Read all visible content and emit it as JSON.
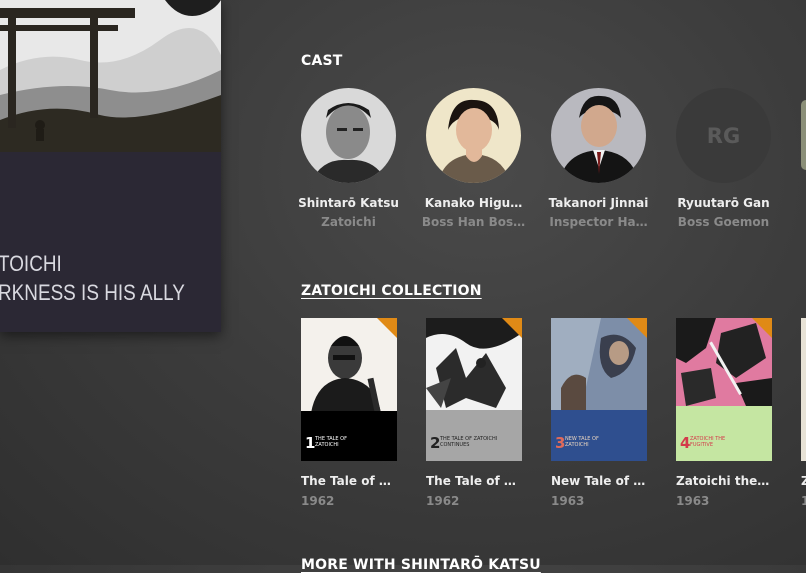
{
  "poster": {
    "title_line1": "TOICHI",
    "title_line2": "RKNESS IS HIS ALLY"
  },
  "cast": {
    "heading": "CAST",
    "members": [
      {
        "name": "Shintarō Katsu",
        "role": "Zatoichi"
      },
      {
        "name": "Kanako Higu…",
        "role": "Boss Han Bos…"
      },
      {
        "name": "Takanori Jinnai",
        "role": "Inspector Ha…"
      },
      {
        "name": "Ryuutarō Gan",
        "role": "Boss Goemon",
        "initials": "RG"
      }
    ]
  },
  "collection": {
    "heading": "ZATOICHI COLLECTION",
    "movies": [
      {
        "title": "The Tale of Z…",
        "year": "1962",
        "num": "1",
        "cover_text": "THE TALE OF ZATOICHI"
      },
      {
        "title": "The Tale of Z…",
        "year": "1962",
        "num": "2",
        "cover_text": "THE TALE OF ZATOICHI CONTINUES"
      },
      {
        "title": "New Tale of Z…",
        "year": "1963",
        "num": "3",
        "cover_text": "NEW TALE OF ZATOICHI"
      },
      {
        "title": "Zatoichi the …",
        "year": "1963",
        "num": "4",
        "cover_text": "ZATOICHI THE FUGITIVE"
      }
    ],
    "partial_title": "Z",
    "partial_year": "1"
  },
  "next_section": {
    "heading": "MORE WITH SHINTARŌ KATSU"
  },
  "colors": {
    "accent": "#e08a16",
    "text_muted": "#8a8a8a"
  }
}
